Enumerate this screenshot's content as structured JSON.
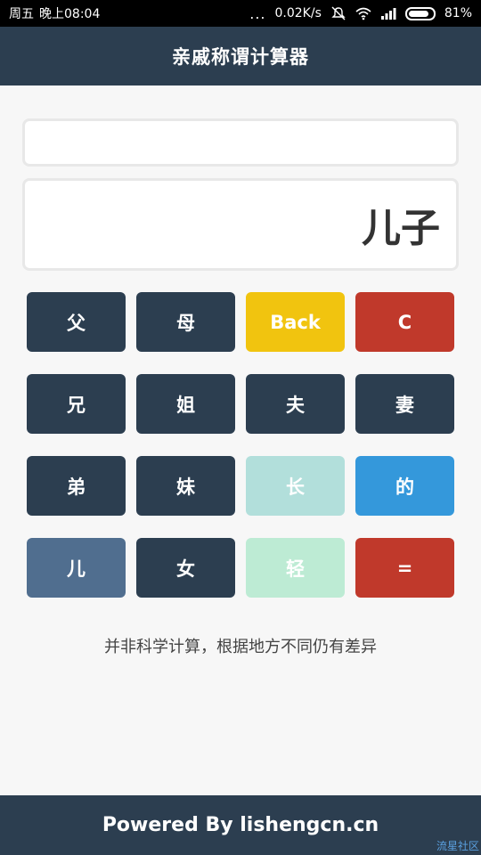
{
  "status_bar": {
    "day": "周五",
    "time": "晚上08:04",
    "dots": "...",
    "net_speed": "0.02K/s",
    "battery": "81%"
  },
  "header": {
    "title": "亲戚称谓计算器"
  },
  "display": {
    "input_value": "",
    "result": "儿子"
  },
  "keys": [
    {
      "label": "父",
      "color": "#2c3e50"
    },
    {
      "label": "母",
      "color": "#2c3e50"
    },
    {
      "label": "Back",
      "color": "#f1c40f"
    },
    {
      "label": "C",
      "color": "#c0392b"
    },
    {
      "label": "兄",
      "color": "#2c3e50"
    },
    {
      "label": "姐",
      "color": "#2c3e50"
    },
    {
      "label": "夫",
      "color": "#2c3e50"
    },
    {
      "label": "妻",
      "color": "#2c3e50"
    },
    {
      "label": "弟",
      "color": "#2c3e50"
    },
    {
      "label": "妹",
      "color": "#2c3e50"
    },
    {
      "label": "长",
      "color": "#b2dfdb"
    },
    {
      "label": "的",
      "color": "#3498db"
    },
    {
      "label": "儿",
      "color": "#506e8f"
    },
    {
      "label": "女",
      "color": "#2c3e50"
    },
    {
      "label": "轻",
      "color": "#bdebd4"
    },
    {
      "label": "=",
      "color": "#c0392b"
    }
  ],
  "note": "并非科学计算，根据地方不同仍有差异",
  "footer": {
    "text": "Powered By lishengcn.cn"
  },
  "watermark": "流星社区"
}
